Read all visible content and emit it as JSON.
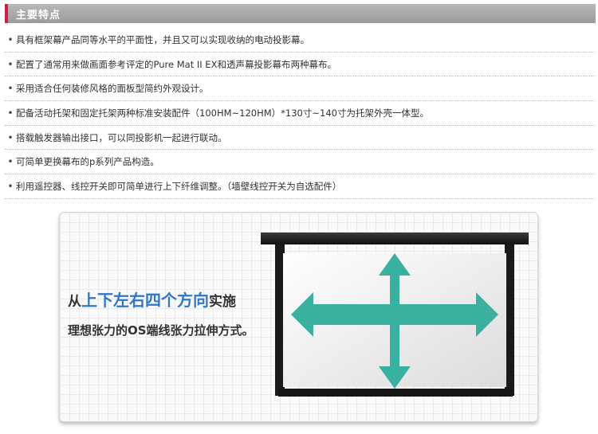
{
  "header": {
    "title": "主要特点"
  },
  "features": {
    "bullet": "•",
    "items": [
      "具有框架幕产品同等水平的平面性，并且又可以实现收纳的电动投影幕。",
      "配置了通常用来做画面参考评定的Pure Mat II EX和透声幕投影幕布两种幕布。",
      "采用适合任何装修风格的面板型简约外观设计。",
      "配备活动托架和固定托架两种标准安装配件（100HM~120HM）*130寸~140寸为托架外壳一体型。",
      "搭载触发器输出接口，可以同投影机一起进行联动。",
      "可简单更换幕布的p系列产品构造。",
      "利用遥控器、线控开关即可简单进行上下纤维调整。（墙壁线控开关为自选配件）"
    ]
  },
  "diagram": {
    "caption": {
      "prefix": "从",
      "highlight": "上下左右四个方向",
      "suffix": "实施",
      "line2": "理想张力的OS端线张力拉伸方式。"
    },
    "colors": {
      "arrow": "#3ab0a0",
      "highlight": "#2f78c6",
      "housing": "#1a1a1a"
    }
  }
}
